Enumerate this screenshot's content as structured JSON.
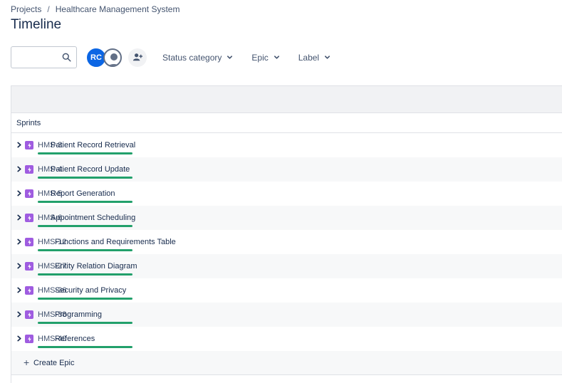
{
  "breadcrumb": {
    "projects": "Projects",
    "separator": "/",
    "project_name": "Healthcare Management System"
  },
  "page": {
    "title": "Timeline"
  },
  "search": {
    "value": "",
    "placeholder": "",
    "icon": "search-icon"
  },
  "avatars": [
    {
      "initials": "RC",
      "color": "#0c66e4"
    },
    {
      "initials": "",
      "icon": "user-icon",
      "color": "#626f86"
    }
  ],
  "add_people": {
    "icon": "add-person-icon"
  },
  "filters": [
    {
      "label": "Status category",
      "icon": "chevron-down-icon"
    },
    {
      "label": "Epic",
      "icon": "chevron-down-icon"
    },
    {
      "label": "Label",
      "icon": "chevron-down-icon"
    }
  ],
  "timeline": {
    "sprints_label": "Sprints",
    "epics": [
      {
        "key": "HMS-3",
        "title": "Patient Record Retrieval",
        "progress": 1.0
      },
      {
        "key": "HMS-4",
        "title": "Patient Record Update",
        "progress": 1.0
      },
      {
        "key": "HMS-5",
        "title": "Report Generation",
        "progress": 1.0
      },
      {
        "key": "HMS-6",
        "title": "Appointment Scheduling",
        "progress": 1.0
      },
      {
        "key": "HMS-12",
        "title": "Functions and Requirements Table",
        "progress": 1.0
      },
      {
        "key": "HMS-27",
        "title": "Entity Relation Diagram",
        "progress": 1.0
      },
      {
        "key": "HMS-36",
        "title": "Security and Privacy",
        "progress": 1.0
      },
      {
        "key": "HMS-38",
        "title": "Programming",
        "progress": 1.0
      },
      {
        "key": "HMS-40",
        "title": "References",
        "progress": 1.0
      }
    ],
    "create_epic_label": "Create Epic"
  },
  "colors": {
    "accent": "#0c66e4",
    "epic": "#9f5ce0",
    "progress_done": "#22a06b"
  }
}
